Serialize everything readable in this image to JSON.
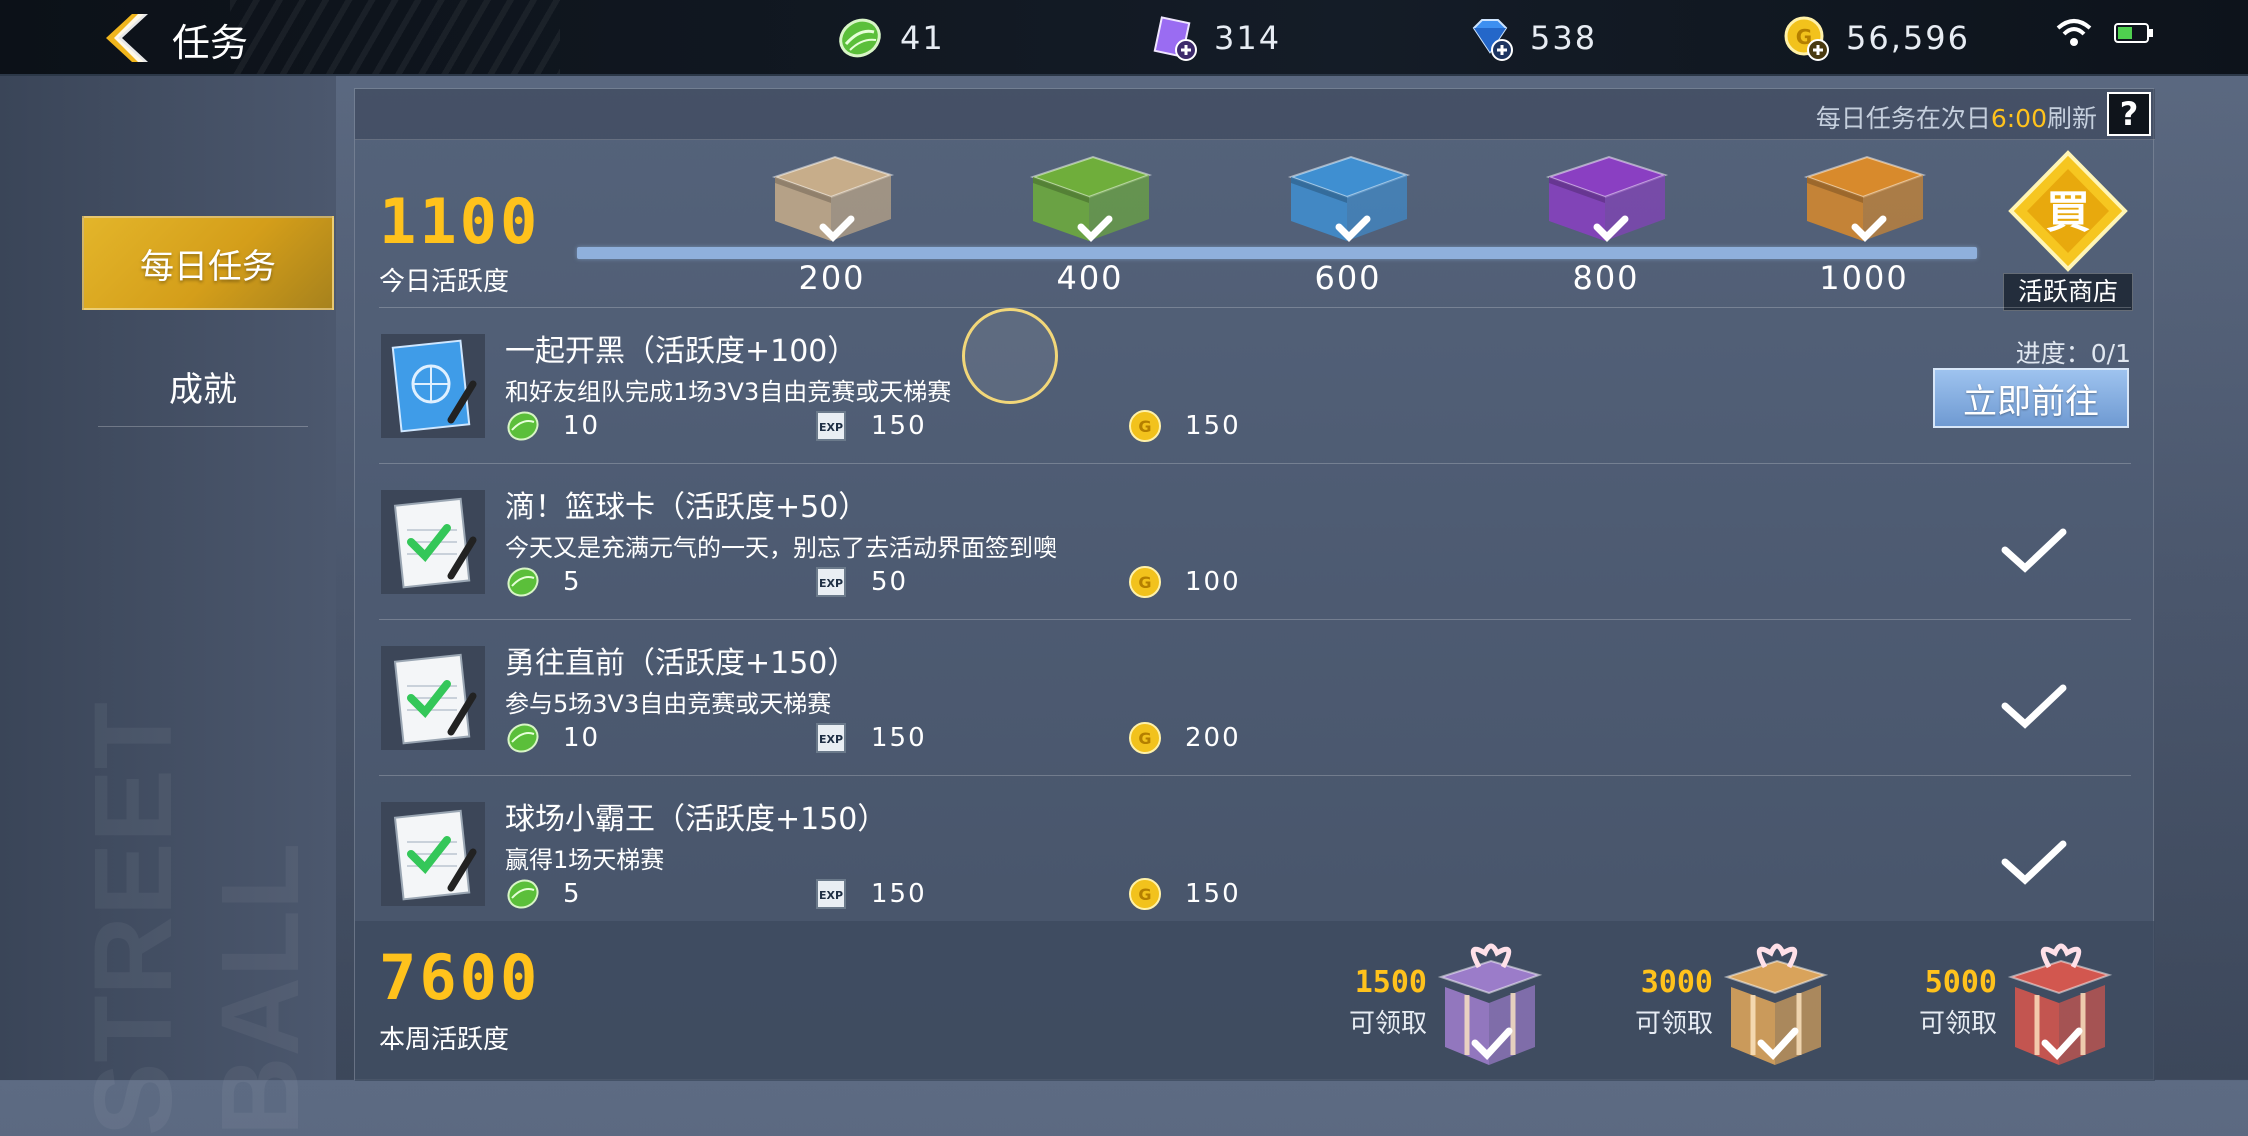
{
  "header": {
    "title": "任务",
    "back_icon": "back-chevron-icon"
  },
  "currencies": [
    {
      "name": "stamina",
      "icon": "green-ball-icon",
      "value": "41"
    },
    {
      "name": "ticket",
      "icon": "purple-card-icon",
      "value": "314"
    },
    {
      "name": "diamond",
      "icon": "blue-diamond-icon",
      "value": "538"
    },
    {
      "name": "gold",
      "icon": "gold-coin-icon",
      "value": "56,596"
    }
  ],
  "sidebar": {
    "daily_tab": "每日任务",
    "achievement_tab": "成就",
    "watermark": "STREET BALL"
  },
  "notice": {
    "prefix": "每日任务在次日",
    "time": "6:00",
    "suffix": "刷新",
    "help": "?"
  },
  "daily": {
    "score": "1100",
    "label": "今日活跃度",
    "boxes": [
      {
        "threshold": "200",
        "color": "#c7ad8a",
        "claimed": true
      },
      {
        "threshold": "400",
        "color": "#6fae3b",
        "claimed": true
      },
      {
        "threshold": "600",
        "color": "#3f8fd1",
        "claimed": true
      },
      {
        "threshold": "800",
        "color": "#8a3fc2",
        "claimed": true
      },
      {
        "threshold": "1000",
        "color": "#d88a2c",
        "claimed": true
      }
    ],
    "progress_fraction": 1.0,
    "shop_label": "活跃商店"
  },
  "tasks": [
    {
      "name": "一起开黑（活跃度+100）",
      "desc": "和好友组队完成1场3V3自由竞赛或天梯赛",
      "rewards": {
        "ball": "10",
        "exp": "150",
        "gold": "150"
      },
      "progress": "进度：0/1",
      "action": "立即前往",
      "done": false,
      "icon": "blue-notebook-icon"
    },
    {
      "name": "滴！篮球卡（活跃度+50）",
      "desc": "今天又是充满元气的一天，别忘了去活动界面签到噢",
      "rewards": {
        "ball": "5",
        "exp": "50",
        "gold": "100"
      },
      "progress": "",
      "action": "",
      "done": true,
      "icon": "checked-notebook-icon"
    },
    {
      "name": "勇往直前（活跃度+150）",
      "desc": "参与5场3V3自由竞赛或天梯赛",
      "rewards": {
        "ball": "10",
        "exp": "150",
        "gold": "200"
      },
      "progress": "",
      "action": "",
      "done": true,
      "icon": "checked-notebook-icon"
    },
    {
      "name": "球场小霸王（活跃度+150）",
      "desc": "赢得1场天梯赛",
      "rewards": {
        "ball": "5",
        "exp": "150",
        "gold": "150"
      },
      "progress": "",
      "action": "",
      "done": true,
      "icon": "checked-notebook-icon"
    }
  ],
  "weekly": {
    "score": "7600",
    "label": "本周活跃度",
    "gifts": [
      {
        "threshold": "1500",
        "status": "可领取",
        "color": "#9b7cc9"
      },
      {
        "threshold": "3000",
        "status": "可领取",
        "color": "#d9a35b"
      },
      {
        "threshold": "5000",
        "status": "可领取",
        "color": "#d2574f"
      }
    ]
  }
}
